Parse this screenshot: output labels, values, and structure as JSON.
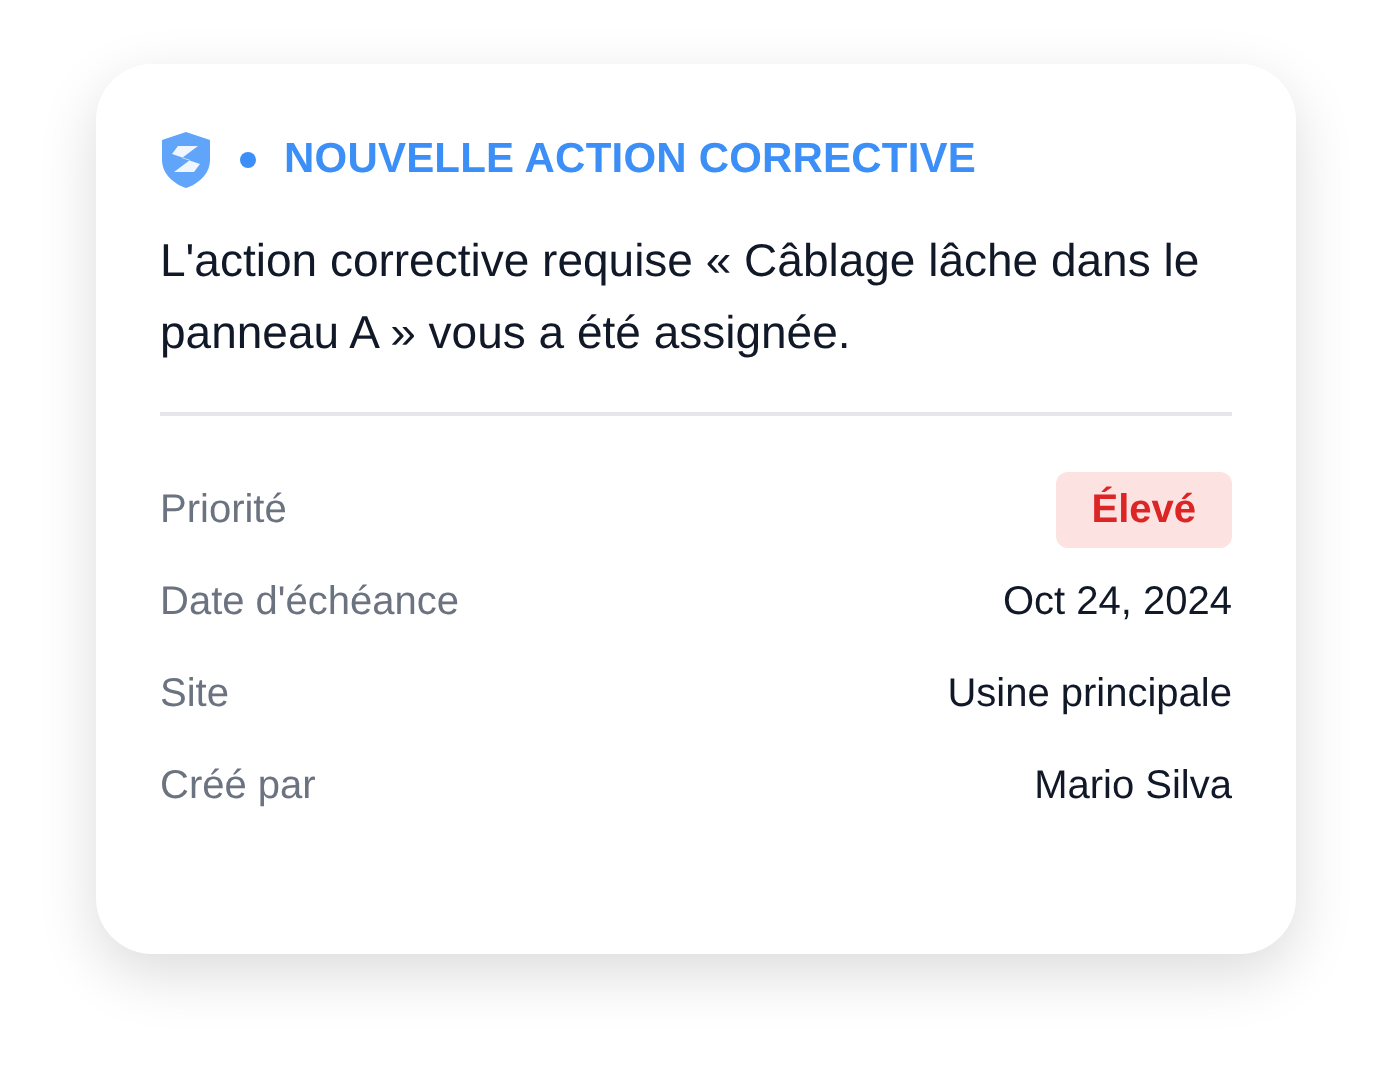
{
  "header": {
    "title": "NOUVELLE ACTION CORRECTIVE"
  },
  "message": "L'action corrective requise « Câblage lâche dans le panneau A » vous a été assignée.",
  "details": [
    {
      "label": "Priorité",
      "value": "Élevé",
      "kind": "badge"
    },
    {
      "label": "Date d'échéance",
      "value": "Oct 24, 2024",
      "kind": "text"
    },
    {
      "label": "Site",
      "value": "Usine principale",
      "kind": "text"
    },
    {
      "label": "Créé par",
      "value": "Mario Silva",
      "kind": "text"
    }
  ]
}
